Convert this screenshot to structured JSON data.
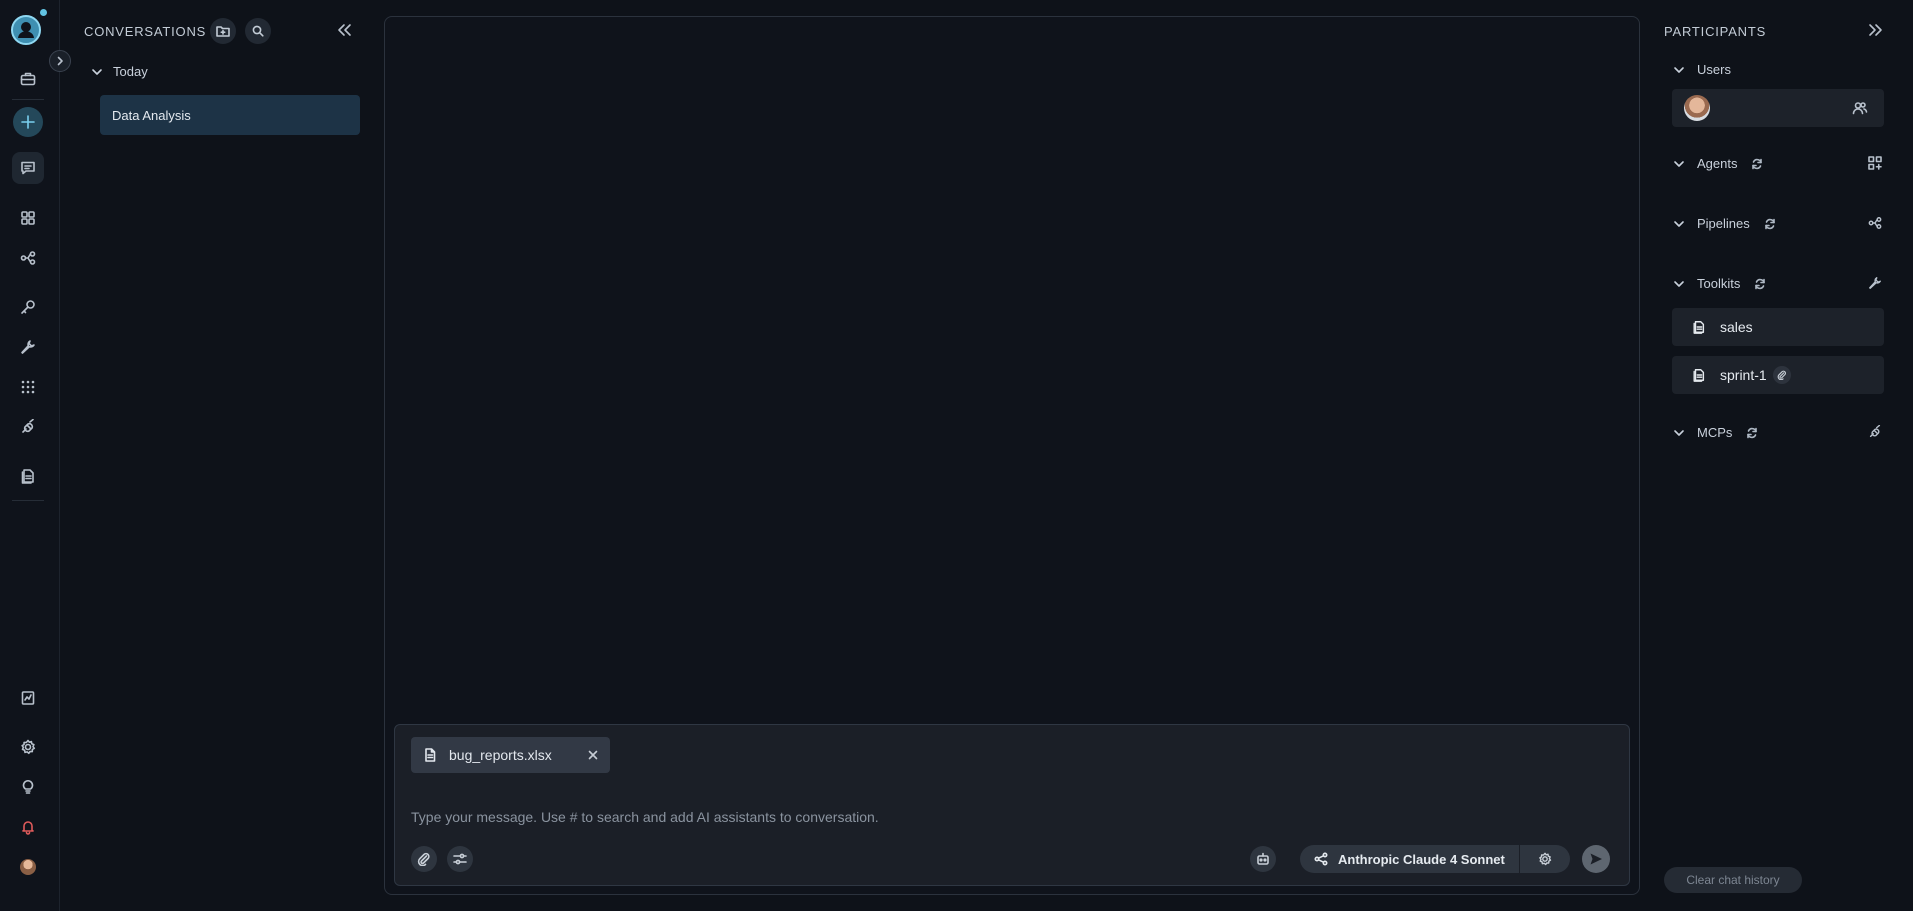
{
  "conversations": {
    "title": "CONVERSATIONS",
    "groups": [
      {
        "label": "Today",
        "items": [
          {
            "label": "Data Analysis"
          }
        ]
      }
    ]
  },
  "composer": {
    "attachment": {
      "file_name": "bug_reports.xlsx"
    },
    "placeholder": "Type your message. Use # to search and add AI assistants to conversation.",
    "model_label": "Anthropic Claude 4 Sonnet"
  },
  "participants": {
    "title": "PARTICIPANTS",
    "sections": {
      "users": "Users",
      "agents": "Agents",
      "pipelines": "Pipelines",
      "toolkits": "Toolkits",
      "mcps": "MCPs"
    },
    "toolkits": [
      {
        "label": "sales"
      },
      {
        "label": "sprint-1"
      }
    ],
    "clear_label": "Clear chat history"
  },
  "colors": {
    "background": "#0e1219",
    "selected_item": "#1d3346",
    "accent": "#62c3e3"
  }
}
